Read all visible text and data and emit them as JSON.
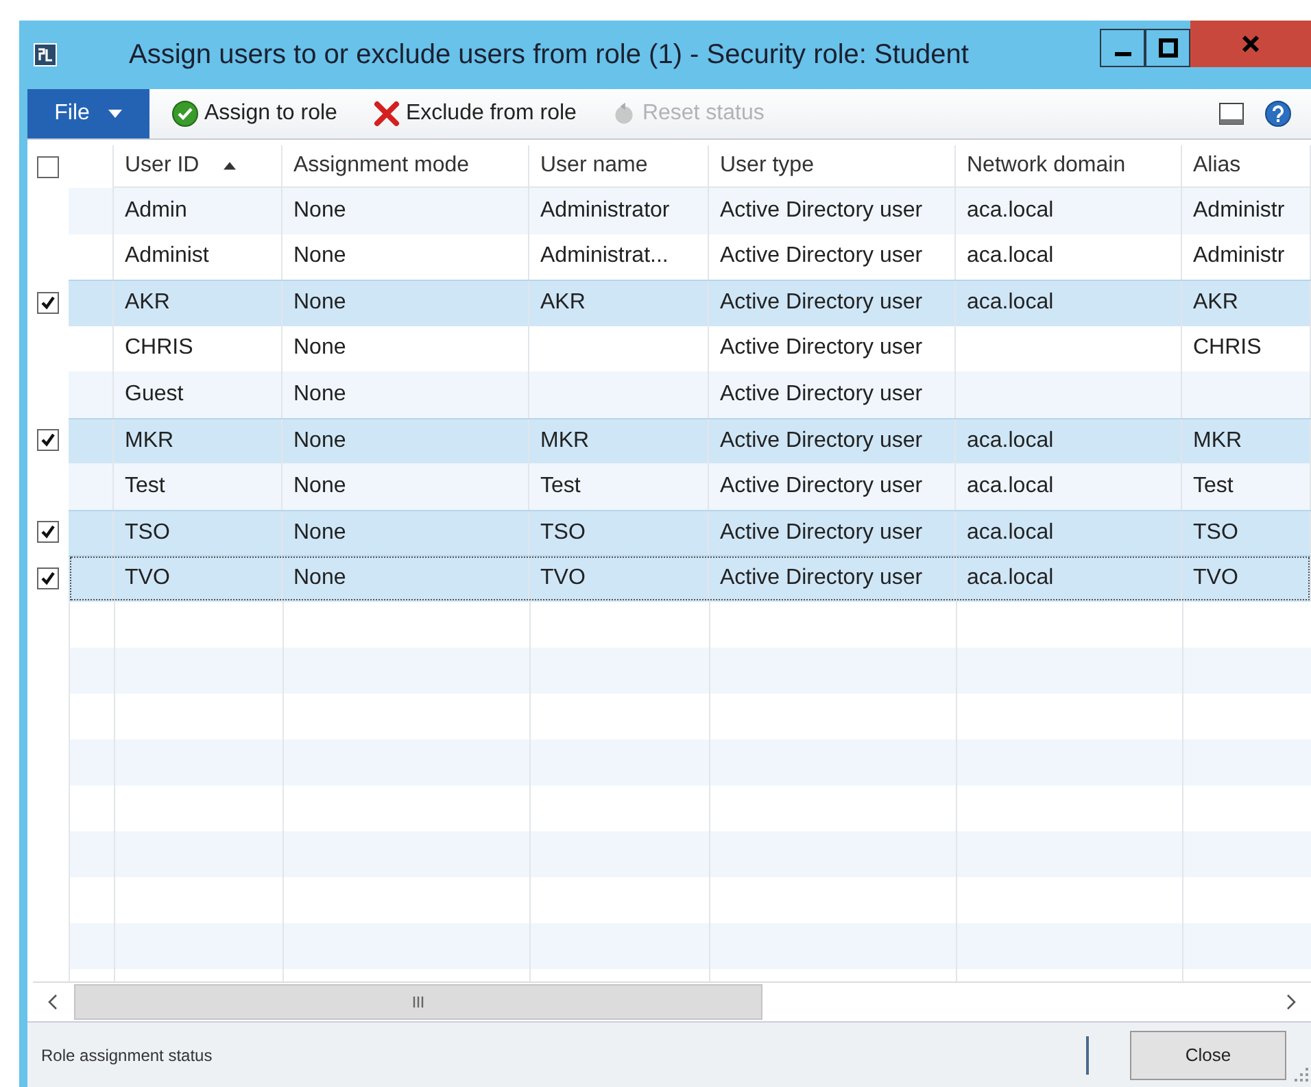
{
  "window": {
    "title": "Assign users to or exclude users from role (1) - Security role: Student"
  },
  "toolbar": {
    "file_menu": "File",
    "buttons": [
      {
        "kind": "assign",
        "label": "Assign to role",
        "disabled": false
      },
      {
        "kind": "exclude",
        "label": "Exclude from role",
        "disabled": false
      },
      {
        "kind": "reset",
        "label": "Reset status",
        "disabled": true
      }
    ]
  },
  "table": {
    "select_all_checked": false,
    "columns": [
      {
        "label": "User ID",
        "sorted": true
      },
      {
        "label": "Assignment mode",
        "sorted": false
      },
      {
        "label": "User name",
        "sorted": false
      },
      {
        "label": "User type",
        "sorted": false
      },
      {
        "label": "Network domain",
        "sorted": false
      },
      {
        "label": "Alias",
        "sorted": false
      }
    ],
    "rows": [
      {
        "selected": false,
        "focused": false,
        "cells": [
          "Admin",
          "None",
          "Administrator",
          "Active Directory user",
          "aca.local",
          "Administr"
        ]
      },
      {
        "selected": false,
        "focused": false,
        "cells": [
          "Administ",
          "None",
          "Administrat...",
          "Active Directory user",
          "aca.local",
          "Administr"
        ]
      },
      {
        "selected": true,
        "focused": false,
        "cells": [
          "AKR",
          "None",
          "AKR",
          "Active Directory user",
          "aca.local",
          "AKR"
        ]
      },
      {
        "selected": false,
        "focused": false,
        "cells": [
          "CHRIS",
          "None",
          "",
          "Active Directory user",
          "",
          "CHRIS"
        ]
      },
      {
        "selected": false,
        "focused": false,
        "cells": [
          "Guest",
          "None",
          "",
          "Active Directory user",
          "",
          ""
        ]
      },
      {
        "selected": true,
        "focused": false,
        "cells": [
          "MKR",
          "None",
          "MKR",
          "Active Directory user",
          "aca.local",
          "MKR"
        ]
      },
      {
        "selected": false,
        "focused": false,
        "cells": [
          "Test",
          "None",
          "Test",
          "Active Directory user",
          "aca.local",
          "Test"
        ]
      },
      {
        "selected": true,
        "focused": false,
        "cells": [
          "TSO",
          "None",
          "TSO",
          "Active Directory user",
          "aca.local",
          "TSO"
        ]
      },
      {
        "selected": true,
        "focused": true,
        "cells": [
          "TVO",
          "None",
          "TVO",
          "Active Directory user",
          "aca.local",
          "TVO"
        ]
      }
    ]
  },
  "status_bar": {
    "text": "Role assignment status",
    "close_button": "Close"
  }
}
